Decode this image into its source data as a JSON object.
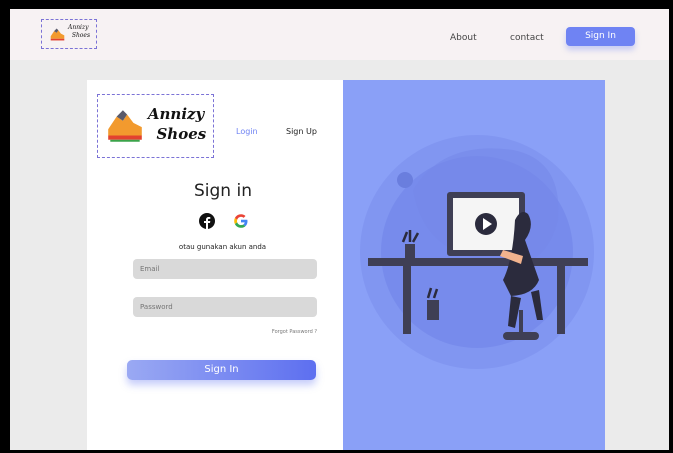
{
  "navbar": {
    "logo_line1": "Annizy",
    "logo_line2": "Shoes",
    "links": [
      "About",
      "contact"
    ],
    "signin_label": "Sign In"
  },
  "card": {
    "logo_line1": "Annizy",
    "logo_line2": "Shoes",
    "tabs": {
      "login": "Login",
      "signup": "Sign Up"
    },
    "title": "Sign in",
    "alt_text": "otau gunakan akun anda",
    "email_placeholder": "Email",
    "password_placeholder": "Password",
    "forgot_label": "Forgot Password ?",
    "signin_label": "Sign In"
  },
  "colors": {
    "accent": "#6f83f3",
    "panel": "#8aa0f7",
    "link_active": "#6f83f3"
  },
  "icons": [
    "shoe-logo-icon",
    "facebook-icon",
    "google-icon",
    "video-play-icon"
  ]
}
